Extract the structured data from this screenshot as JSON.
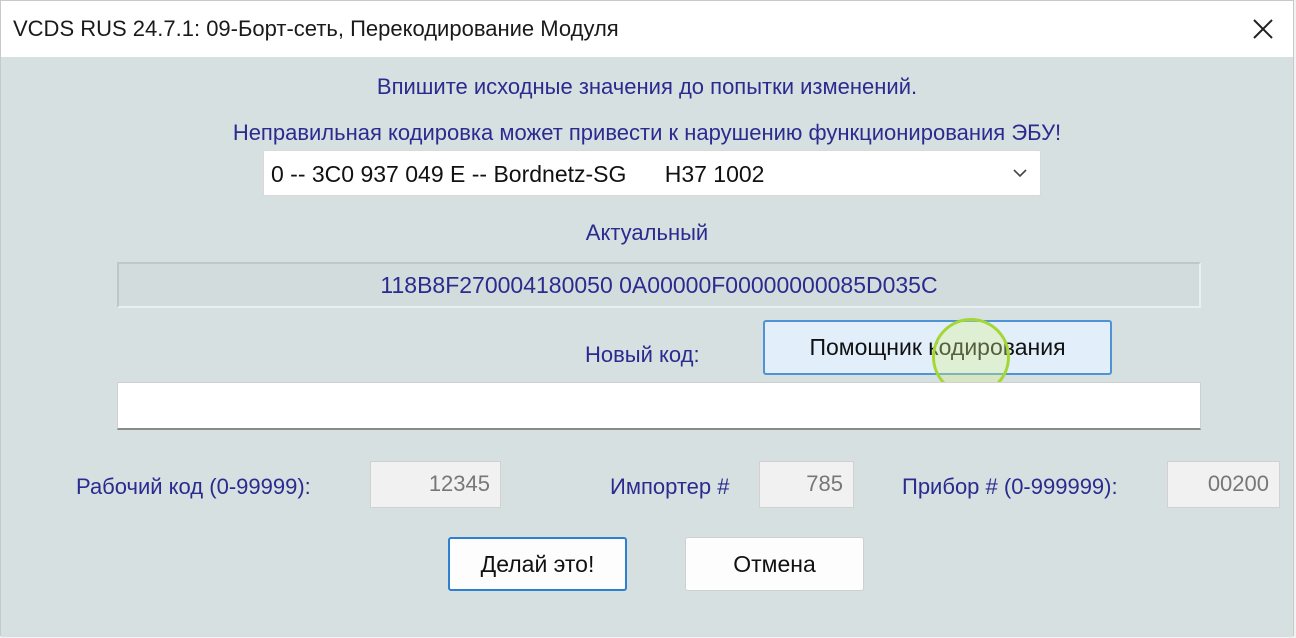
{
  "window": {
    "title": "VCDS RUS 24.7.1: 09-Борт-сеть,  Перекодирование Модуля",
    "close_icon": "close-icon"
  },
  "header": {
    "line1": "Впишите исходные значения до попытки изменений.",
    "line2": "Неправильная кодировка может привести к нарушению функционирования ЭБУ!"
  },
  "module_select": {
    "value": "0 -- 3C0 937 049 E -- Bordnetz-SG      H37 1002",
    "arrow_icon": "chevron-down-icon"
  },
  "actual": {
    "label": "Актуальный",
    "value": "118B8F270004180050 0A00000F00000000085D035C"
  },
  "new_code": {
    "label": "Новый код:",
    "helper_button": "Помощник кодирования",
    "value": ""
  },
  "fields": {
    "workshop_label": "Рабочий код (0-99999):",
    "workshop_value": "12345",
    "importer_label": "Импортер #",
    "importer_value": "785",
    "device_label": "Прибор # (0-999999):",
    "device_value": "00200"
  },
  "buttons": {
    "do_it": "Делай это!",
    "cancel": "Отмена"
  },
  "colors": {
    "accent_text": "#2b2b8f",
    "dialog_bg": "#d6e0e0",
    "focus_border": "#2f7fd0"
  }
}
